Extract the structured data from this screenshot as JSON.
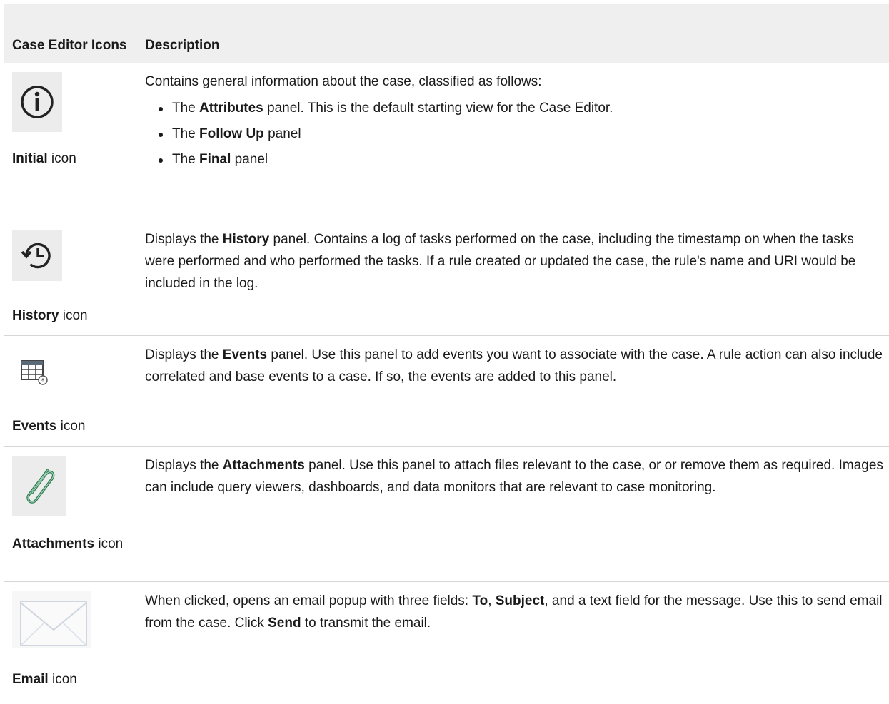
{
  "table": {
    "header": {
      "col1": "Case Editor Icons",
      "col2": "Description"
    },
    "rows": {
      "initial": {
        "icon": "info-icon",
        "caption_bold": "Initial",
        "caption_rest": " icon",
        "intro": "Contains general information about the case, classified as follows:",
        "bullets": [
          {
            "pre": "The ",
            "bold": "Attributes",
            "post": " panel. This is the default starting view for the Case Editor."
          },
          {
            "pre": "The ",
            "bold": "Follow Up",
            "post": " panel"
          },
          {
            "pre": "The ",
            "bold": "Final",
            "post": " panel"
          }
        ]
      },
      "history": {
        "icon": "history-icon",
        "caption_bold": "History",
        "caption_rest": " icon",
        "pre": "Displays the ",
        "bold": "History",
        "post": " panel. Contains a log of tasks performed on the case, including the timestamp on when the tasks were performed and who performed the tasks. If a rule created or updated the case, the rule's name and URI would be included in the log."
      },
      "events": {
        "icon": "events-grid-icon",
        "caption_bold": "Events",
        "caption_rest": " icon",
        "pre": "Displays the ",
        "bold": "Events",
        "post": " panel. Use this panel to add events you want to associate with the case. A rule action can also include correlated and base events to a case. If so, the events are added to this panel."
      },
      "attachments": {
        "icon": "paperclip-icon",
        "caption_bold": "Attachments",
        "caption_rest": " icon",
        "pre": "Displays the ",
        "bold": "Attachments",
        "post": " panel. Use this panel to attach files relevant to the case, or or remove them as required. Images can include query viewers, dashboards, and data monitors that are relevant to case monitoring."
      },
      "email": {
        "icon": "envelope-icon",
        "caption_bold": "Email",
        "caption_rest": " icon",
        "t1": "When clicked, opens an email popup with three fields: ",
        "b1": "To",
        "t2": ", ",
        "b2": "Subject",
        "t3": ", and a text field for the message. Use this to send email from the case. Click ",
        "b3": "Send",
        "t4": " to transmit the email."
      }
    }
  }
}
